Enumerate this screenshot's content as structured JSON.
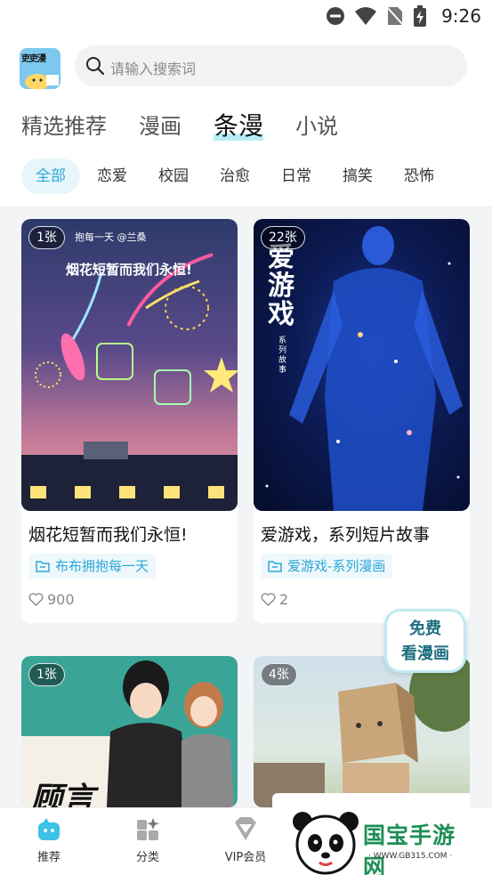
{
  "status_bar": {
    "time": "9:26"
  },
  "app": {
    "logo_text": "吏吏漫"
  },
  "search": {
    "placeholder": "请输入搜索词"
  },
  "tabs": [
    {
      "label": "精选推荐",
      "active": false
    },
    {
      "label": "漫画",
      "active": false
    },
    {
      "label": "条漫",
      "active": true
    },
    {
      "label": "小说",
      "active": false
    }
  ],
  "categories": [
    {
      "label": "全部",
      "active": true
    },
    {
      "label": "恋爱",
      "active": false
    },
    {
      "label": "校园",
      "active": false
    },
    {
      "label": "治愈",
      "active": false
    },
    {
      "label": "日常",
      "active": false
    },
    {
      "label": "搞笑",
      "active": false
    },
    {
      "label": "恐怖",
      "active": false
    }
  ],
  "cards": [
    {
      "count": "1张",
      "cover_text": "烟花短暂而我们永恒!",
      "cover_top_text": "抱每一天  @兰桑",
      "title": "烟花短暂而我们永恒!",
      "tag": "布布拥抱每一天",
      "likes": "900"
    },
    {
      "count": "22张",
      "cover_title": "爱游戏",
      "cover_sub": "系列故事",
      "title": "爱游戏，系列短片故事",
      "tag": "爱游戏-系列漫画",
      "likes": "2"
    },
    {
      "count": "1张",
      "cover_text": "顾言"
    },
    {
      "count": "4张"
    }
  ],
  "floating": {
    "line1": "免费",
    "line2": "看漫画"
  },
  "bottom_nav": [
    {
      "label": "推荐",
      "icon": "recommend-icon",
      "active": true
    },
    {
      "label": "分类",
      "icon": "category-icon",
      "active": false
    },
    {
      "label": "VIP会员",
      "icon": "vip-diamond-icon",
      "active": false
    }
  ],
  "watermark": {
    "brand": "国宝手游网",
    "url": "· WWW.GB315.COM ·"
  },
  "colors": {
    "accent": "#2aa7d6",
    "tab_underline": "#b9ecf6",
    "chip_bg": "#e8f6fb"
  }
}
